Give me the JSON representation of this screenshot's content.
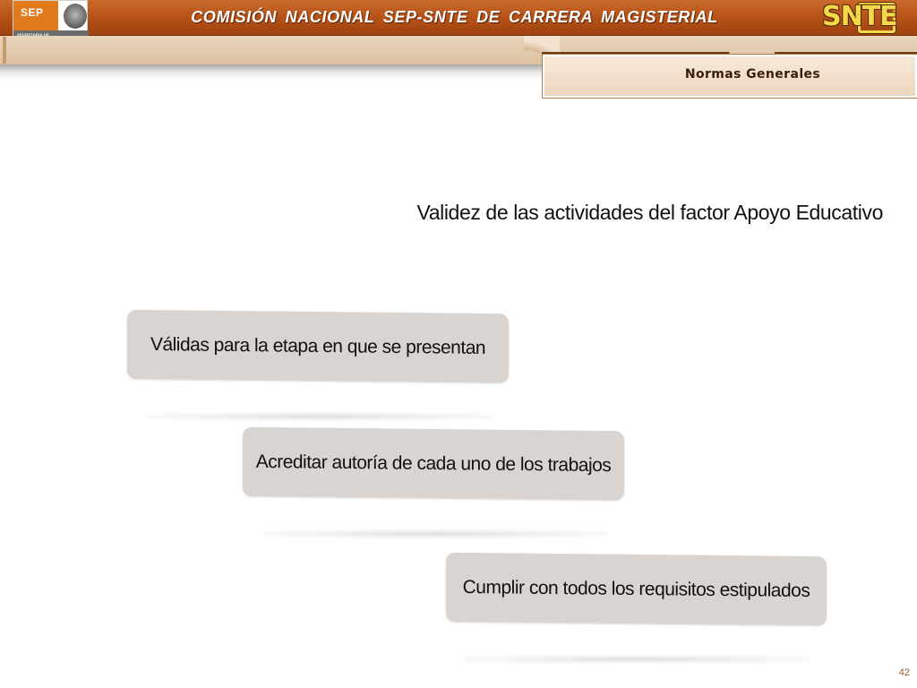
{
  "header": {
    "title": "COMISIÓN  NACIONAL  SEP-SNTE  DE  CARRERA  MAGISTERIAL",
    "sep_logo": {
      "text": "SEP",
      "line1": "SECRETARÍA DE",
      "line2": "EDUCACIÓN PÚBLICA"
    },
    "snte_logo": {
      "text": "SNTE"
    },
    "bar_color": "#b45016"
  },
  "tab": {
    "label": "Normas Generales"
  },
  "subtitle": "Validez de las actividades del factor Apoyo Educativo",
  "items": [
    {
      "label": "Válidas para la etapa en que se presentan"
    },
    {
      "label": "Acreditar autoría de cada uno de los trabajos"
    },
    {
      "label": "Cumplir con todos los requisitos estipulados"
    }
  ],
  "page_number": "42",
  "colors": {
    "box_fill": "#d9d4d0",
    "band": "#dcc1a2",
    "accent": "#b45016"
  }
}
